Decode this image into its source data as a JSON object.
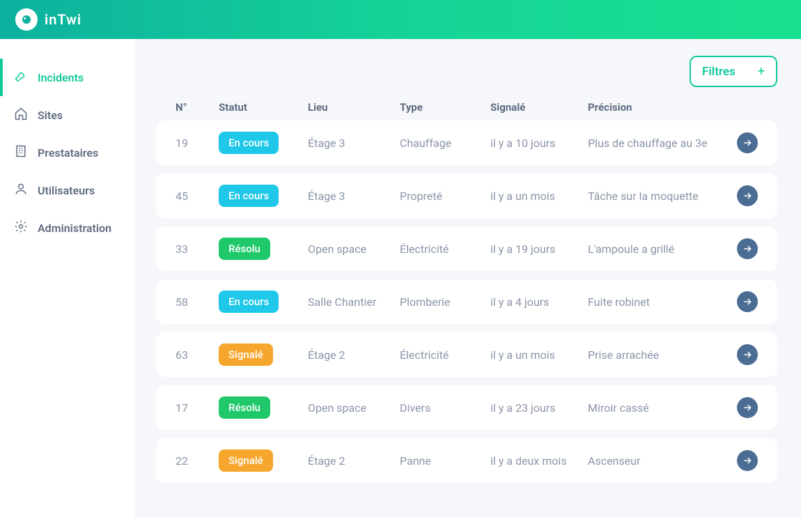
{
  "brand": "inTwi",
  "sidebar": {
    "items": [
      {
        "label": "Incidents",
        "icon": "wrench-icon",
        "active": true
      },
      {
        "label": "Sites",
        "icon": "home-icon",
        "active": false
      },
      {
        "label": "Prestataires",
        "icon": "building-icon",
        "active": false
      },
      {
        "label": "Utilisateurs",
        "icon": "user-icon",
        "active": false
      },
      {
        "label": "Administration",
        "icon": "gear-icon",
        "active": false
      }
    ]
  },
  "toolbar": {
    "filters_label": "Filtres",
    "filters_plus": "+"
  },
  "table": {
    "headers": {
      "num": "N°",
      "statut": "Statut",
      "lieu": "Lieu",
      "type": "Type",
      "signale": "Signalé",
      "precision": "Précision"
    },
    "status_labels": {
      "encours": "En cours",
      "resolu": "Résolu",
      "signale": "Signalé"
    },
    "rows": [
      {
        "num": "19",
        "status": "encours",
        "lieu": "Étage 3",
        "type": "Chauffage",
        "signale": "il y a 10 jours",
        "precision": "Plus de chauffage au 3e"
      },
      {
        "num": "45",
        "status": "encours",
        "lieu": "Étage 3",
        "type": "Propreté",
        "signale": "il y a un mois",
        "precision": "Tâche sur la moquette"
      },
      {
        "num": "33",
        "status": "resolu",
        "lieu": "Open space",
        "type": "Électricité",
        "signale": "il y a 19 jours",
        "precision": "L'ampoule a grillé"
      },
      {
        "num": "58",
        "status": "encours",
        "lieu": "Salle Chantier",
        "type": "Plomberie",
        "signale": "il y a 4 jours",
        "precision": "Fuite robinet"
      },
      {
        "num": "63",
        "status": "signale",
        "lieu": "Étage 2",
        "type": "Électricité",
        "signale": "il y a un mois",
        "precision": "Prise arrachée"
      },
      {
        "num": "17",
        "status": "resolu",
        "lieu": "Open space",
        "type": "Divers",
        "signale": "il y a 23 jours",
        "precision": "Miroir cassé"
      },
      {
        "num": "22",
        "status": "signale",
        "lieu": "Étage 2",
        "type": "Panne",
        "signale": "il y a deux mois",
        "precision": "Ascenseur"
      }
    ]
  },
  "colors": {
    "accent": "#11c99b",
    "status_encours": "#1fc8e8",
    "status_resolu": "#1fc96a",
    "status_signale": "#f7a62d",
    "go_btn": "#4b6c93"
  }
}
